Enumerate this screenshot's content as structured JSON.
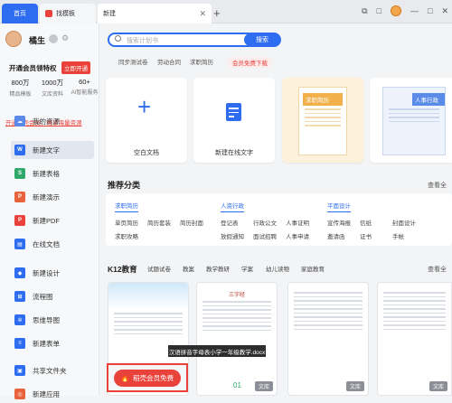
{
  "tabs": {
    "home": "首页",
    "templates": "找模板",
    "new": "新建"
  },
  "window": {
    "controls": [
      "⧉",
      "□",
      "—",
      "□",
      "✕"
    ]
  },
  "profile": {
    "name": "橘生",
    "vip_text": "开通会员领特权",
    "vip_button": "立即开通",
    "stats": [
      {
        "value": "800万",
        "label": "精品模板"
      },
      {
        "value": "1000万",
        "label": "文库资料"
      },
      {
        "value": "60+",
        "label": "AI智能服务"
      }
    ],
    "link": "开通稻壳会员，畅享海量资源"
  },
  "nav": [
    {
      "label": "我的资源",
      "icon": "cloud-icon",
      "color": "#5a8be8"
    },
    {
      "label": "新建文字",
      "icon": "word-icon",
      "color": "#2f6df0"
    },
    {
      "label": "新建表格",
      "icon": "sheet-icon",
      "color": "#2fa86a"
    },
    {
      "label": "新建演示",
      "icon": "slides-icon",
      "color": "#e8623b"
    },
    {
      "label": "新建PDF",
      "icon": "pdf-icon",
      "color": "#e8423b"
    },
    {
      "label": "在线文档",
      "icon": "online-doc-icon",
      "color": "#2f6df0"
    },
    {
      "label": "新建设计",
      "icon": "design-icon",
      "color": "#2f6df0"
    },
    {
      "label": "流程图",
      "icon": "flowchart-icon",
      "color": "#2f6df0"
    },
    {
      "label": "思维导图",
      "icon": "mindmap-icon",
      "color": "#2f6df0"
    },
    {
      "label": "新建表单",
      "icon": "form-icon",
      "color": "#2f6df0"
    },
    {
      "label": "共享文件夹",
      "icon": "shared-folder-icon",
      "color": "#2f6df0"
    },
    {
      "label": "新建应用",
      "icon": "app-icon",
      "color": "#e8623b"
    }
  ],
  "search": {
    "placeholder": "搜索计划书",
    "button": "搜索"
  },
  "hot_searches": [
    "同步测试卷",
    "劳动合同",
    "求职简历",
    "会员免费下载"
  ],
  "cards": {
    "blank": "空白文档",
    "online": "新建在线文字",
    "card3_title": "求职简历",
    "card4_title": "人事行政"
  },
  "recommend": {
    "title": "推荐分类",
    "see_all": "查看全",
    "groups": [
      {
        "head": "求职简历",
        "items": [
          "单页简历",
          "简历套装",
          "简历封面",
          "求职攻略"
        ]
      },
      {
        "head": "人资行政",
        "items": [
          "登记表",
          "行政公文",
          "人事证明",
          "放假通知",
          "面试招聘",
          "人事申请"
        ]
      },
      {
        "head": "平面设计",
        "items": [
          "宣传海报",
          "信纸",
          "封面设计",
          "邀请函",
          "证书",
          "手帐"
        ]
      }
    ]
  },
  "k12": {
    "title": "K12教育",
    "tabs": [
      "试题试卷",
      "教案",
      "教学教研",
      "学案",
      "幼儿读物",
      "家庭教育"
    ],
    "see_all": "查看全",
    "tooltip": "汉语拼音字母表小学一年级教学.docx",
    "vip_free": "稻壳会员免费",
    "badge": "文库",
    "thumb2_title": "三字经",
    "thumb2_num": "01"
  }
}
